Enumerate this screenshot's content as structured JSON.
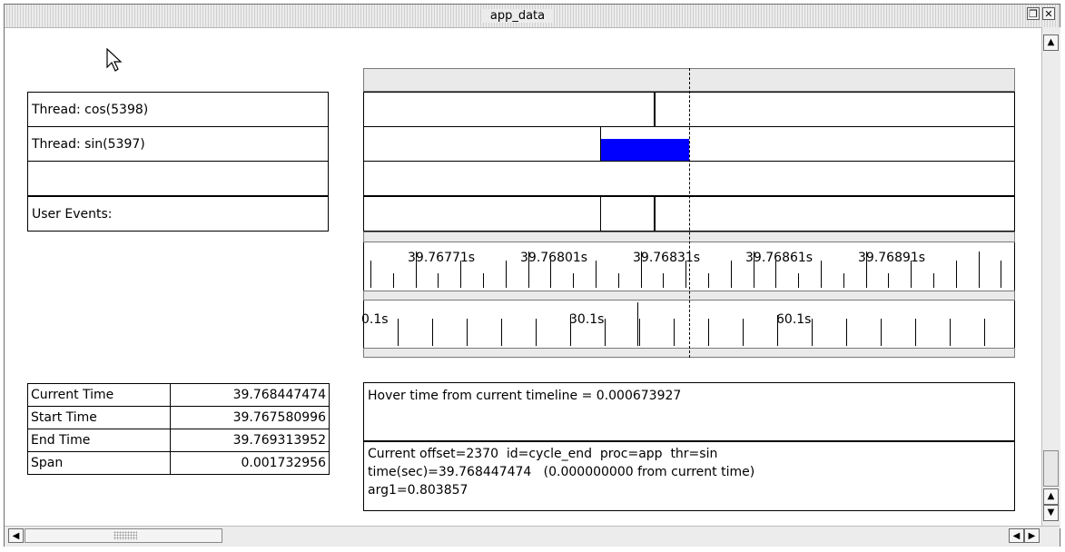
{
  "window": {
    "title": "app_data"
  },
  "threads": [
    {
      "label": "Thread: cos(5398)"
    },
    {
      "label": "Thread: sin(5397)"
    },
    {
      "label": ""
    },
    {
      "label": "User Events:"
    }
  ],
  "colors": {
    "activity": "#0000ff"
  },
  "zoom_axis": {
    "labels": [
      "39.76771s",
      "39.76801s",
      "39.76831s",
      "39.76861s",
      "39.76891s"
    ]
  },
  "overview_axis": {
    "labels": [
      "0.1s",
      "30.1s",
      "60.1s"
    ]
  },
  "times": [
    {
      "label": "Current Time",
      "value": "39.768447474"
    },
    {
      "label": "Start Time",
      "value": "39.767580996"
    },
    {
      "label": "End Time",
      "value": "39.769313952"
    },
    {
      "label": "Span",
      "value": "0.001732956"
    }
  ],
  "hover": {
    "text": "Hover time from current timeline = 0.000673927"
  },
  "event": {
    "line1": "Current offset=2370  id=cycle_end  proc=app  thr=sin",
    "line2": "time(sec)=39.768447474   (0.000000000 from current time)",
    "line3": "arg1=0.803857"
  },
  "icons": {
    "restore": "restore-icon",
    "close": "close-icon",
    "pointer": "mouse-pointer-icon",
    "up": "arrow-up-icon",
    "down": "arrow-down-icon",
    "left": "arrow-left-icon",
    "right": "arrow-right-icon"
  }
}
